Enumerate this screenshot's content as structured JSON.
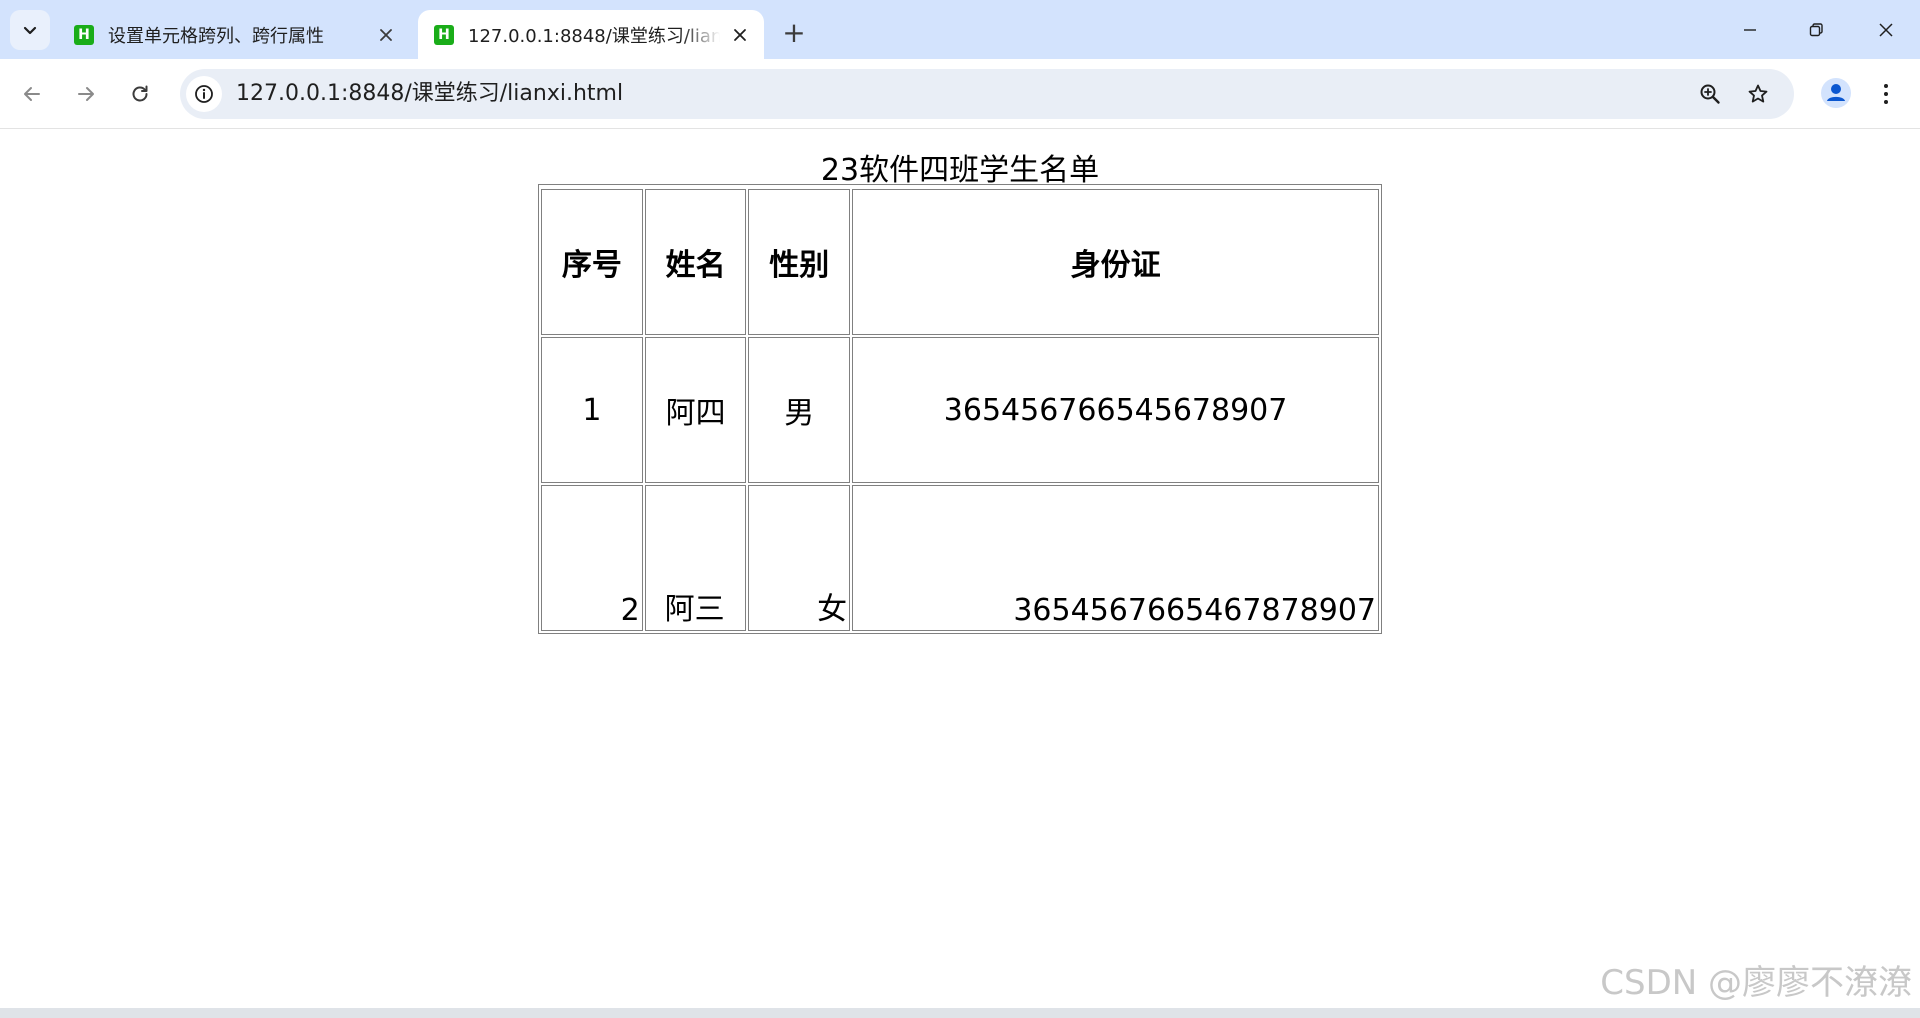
{
  "browser": {
    "tabs": [
      {
        "title": "设置单元格跨列、跨行属性",
        "favicon": "H",
        "active": false
      },
      {
        "title": "127.0.0.1:8848/课堂练习/lianxi.html",
        "favicon": "H",
        "active": true
      }
    ],
    "new_tab_symbol": "+",
    "address": "127.0.0.1:8848/课堂练习/lianxi.html"
  },
  "page": {
    "caption": "23软件四班学生名单",
    "headers": [
      "序号",
      "姓名",
      "性别",
      "身份证"
    ],
    "rows": [
      {
        "no": "1",
        "name": "阿四",
        "gender": "男",
        "id": "365456766545678907",
        "align": "middle"
      },
      {
        "no": "2",
        "name": "阿三",
        "gender": "女",
        "id": "3654567665467878907",
        "align": "bottom"
      }
    ]
  },
  "watermark": "CSDN @廖廖不潦潦",
  "colors": {
    "tabstrip": "#d3e3fd",
    "omnibox": "#e9eef6",
    "favicon": "#1aad19"
  }
}
